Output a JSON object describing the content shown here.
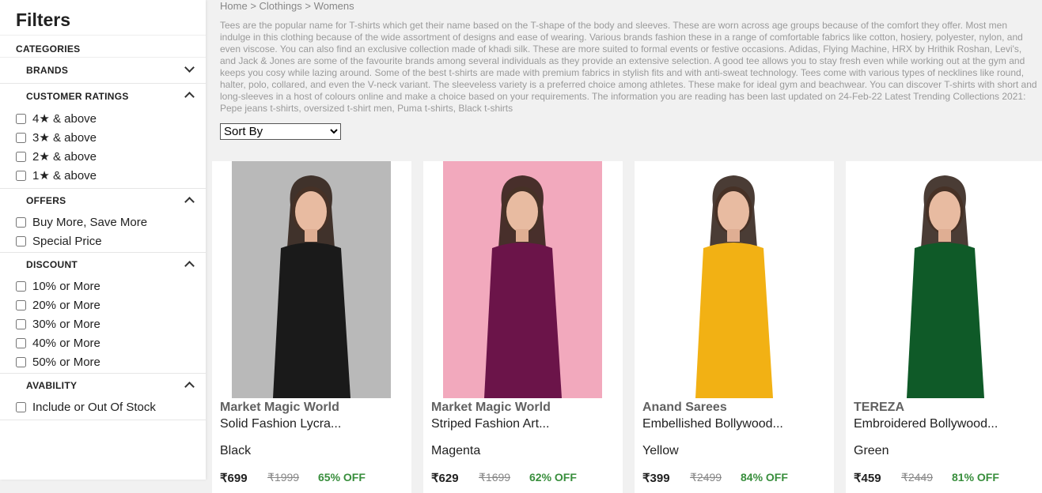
{
  "sidebar": {
    "title": "Filters",
    "categories_label": "CATEGORIES",
    "brands": {
      "label": "BRANDS"
    },
    "ratings": {
      "label": "CUSTOMER RATINGS",
      "options": [
        "4★ & above",
        "3★ & above",
        "2★ & above",
        "1★ & above"
      ]
    },
    "offers": {
      "label": "OFFERS",
      "options": [
        "Buy More, Save More",
        "Special Price"
      ]
    },
    "discount": {
      "label": "DISCOUNT",
      "options": [
        "10% or More",
        "20% or More",
        "30% or More",
        "40% or More",
        "50% or More"
      ]
    },
    "availability": {
      "label": "AVABILITY",
      "options": [
        "Include or Out Of Stock"
      ]
    }
  },
  "breadcrumb": {
    "home": "Home",
    "sep": ">",
    "c1": "Clothings",
    "c2": "Womens"
  },
  "description": "Tees are the popular name for T-shirts which get their name based on the T-shape of the body and sleeves. These are worn across age groups because of the comfort they offer. Most men indulge in this clothing because of the wide assortment of designs and ease of wearing. Various brands fashion these in a range of comfortable fabrics like cotton, hosiery, polyester, nylon, and even viscose. You can also find an exclusive collection made of khadi silk. These are more suited to formal events or festive occasions. Adidas, Flying Machine, HRX by Hrithik Roshan, Levi's, and Jack & Jones are some of the favourite brands among several individuals as they provide an extensive selection. A good tee allows you to stay fresh even while working out at the gym and keeps you cosy while lazing around. Some of the best t-shirts are made with premium fabrics in stylish fits and with anti-sweat technology. Tees come with various types of necklines like round, halter, polo, collared, and even the V-neck variant. The sleeveless variety is a preferred choice among athletes. These make for ideal gym and beachwear. You can discover T-shirts with short and long-sleeves in a host of colours online and make a choice based on your requirements. The information you are reading has been last updated on 24-Feb-22 Latest Trending Collections 2021: Pepe jeans t-shirts, oversized t-shirt men, Puma t-shirts, Black t-shirts",
  "sort": {
    "selected": "Sort By"
  },
  "products": [
    {
      "brand": "Market Magic World",
      "name": "Solid Fashion Lycra...",
      "color": "Black",
      "price": "₹699",
      "mrp": "₹1999",
      "off": "65% OFF",
      "img_bg": "#b9b9b9",
      "garment": "#1a1a1a"
    },
    {
      "brand": "Market Magic World",
      "name": "Striped Fashion Art...",
      "color": "Magenta",
      "price": "₹629",
      "mrp": "₹1699",
      "off": "62% OFF",
      "img_bg": "#f2a9bd",
      "garment": "#6b1449"
    },
    {
      "brand": "Anand Sarees",
      "name": "Embellished Bollywood...",
      "color": "Yellow",
      "price": "₹399",
      "mrp": "₹2499",
      "off": "84% OFF",
      "img_bg": "#ffffff",
      "garment": "#f2b114"
    },
    {
      "brand": "TEREZA",
      "name": "Embroidered Bollywood...",
      "color": "Green",
      "price": "₹459",
      "mrp": "₹2449",
      "off": "81% OFF",
      "img_bg": "#ffffff",
      "garment": "#0f5a28"
    }
  ]
}
